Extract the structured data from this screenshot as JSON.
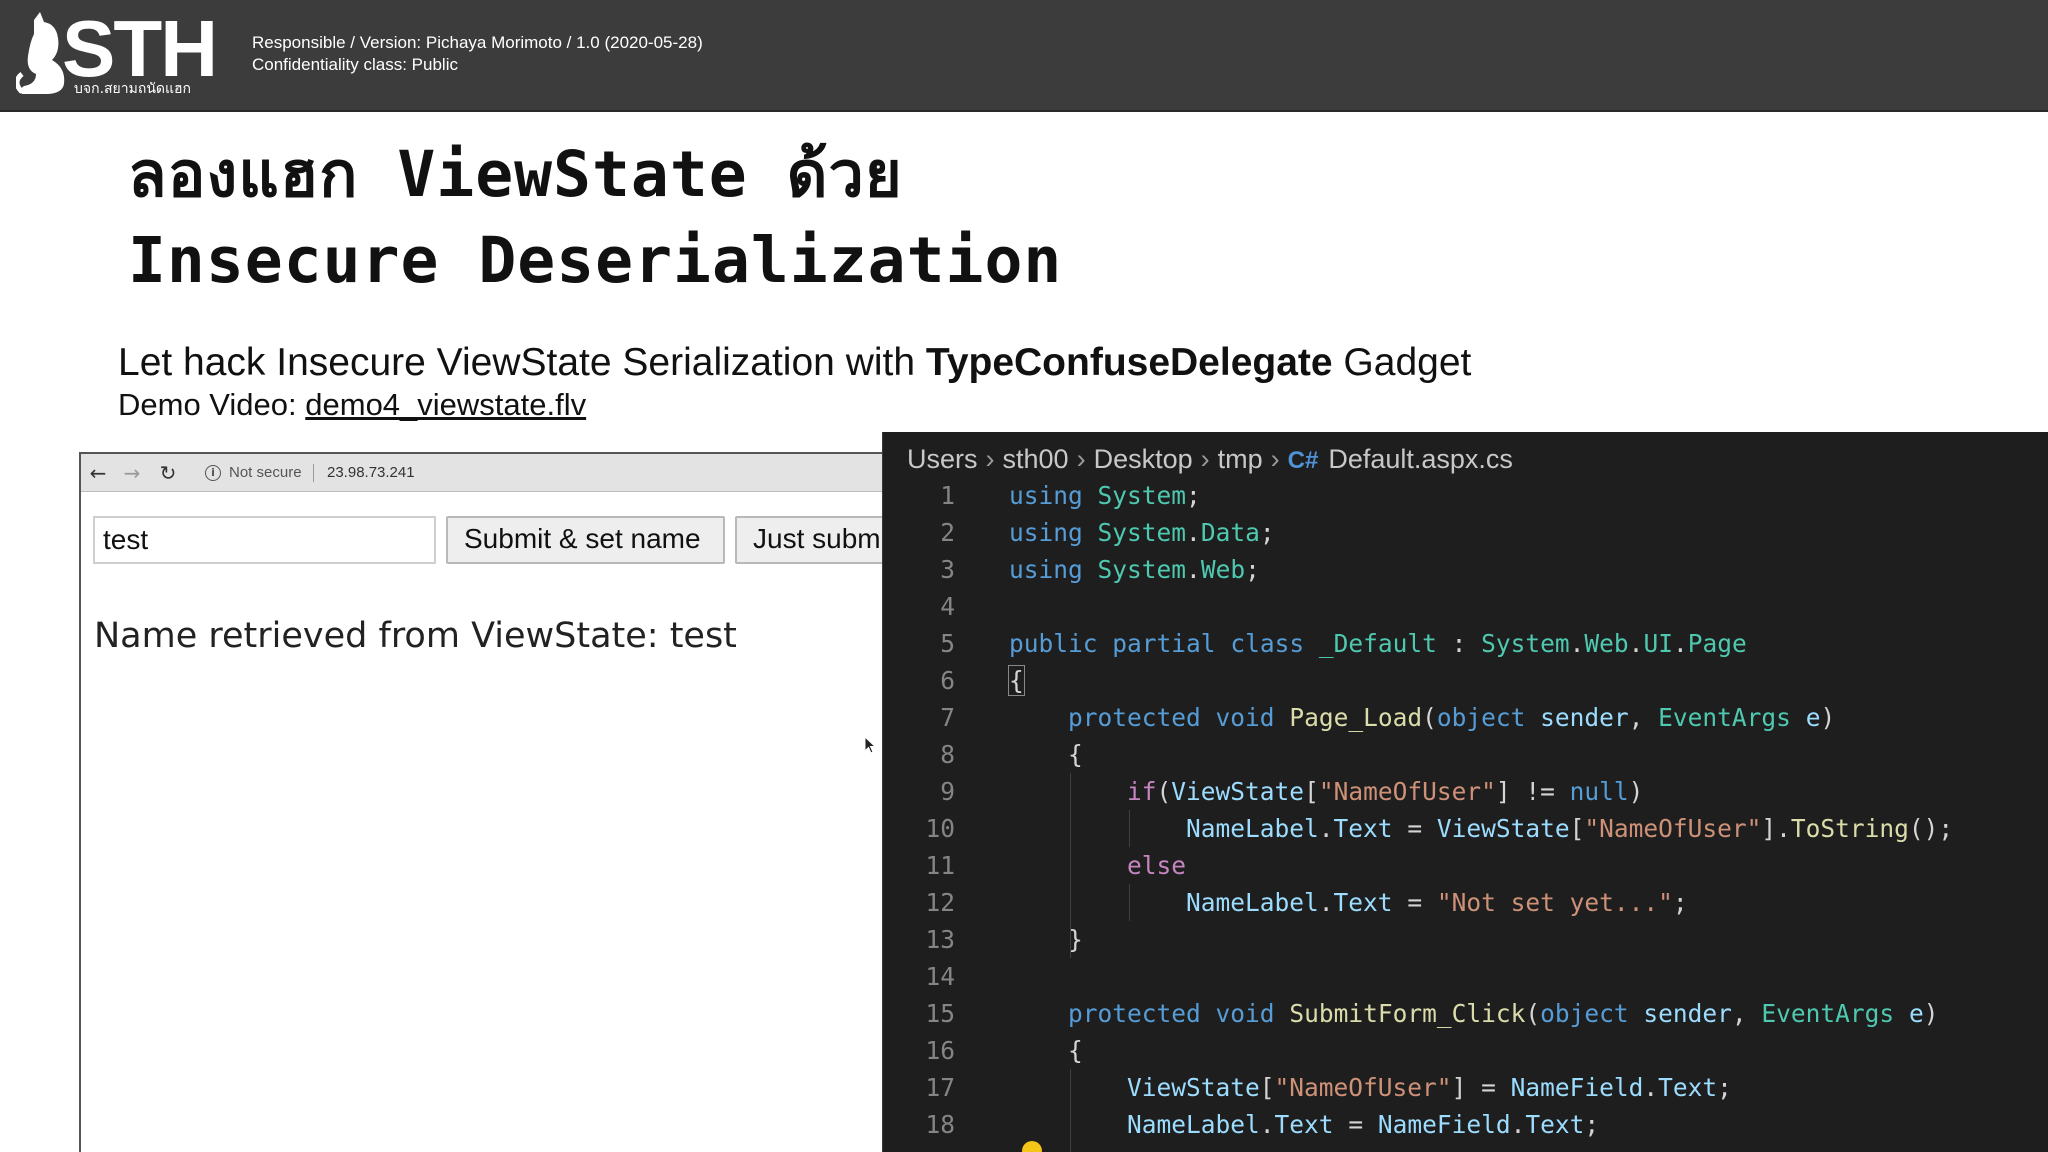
{
  "header": {
    "logo_text": "STH",
    "logo_subtext": "บจก.สยามถนัดแฮก",
    "responsible_line": "Responsible / Version: Pichaya Morimoto / 1.0 (2020-05-28)",
    "confidentiality_line": "Confidentiality class: Public"
  },
  "slide": {
    "title_line1": "ลองแฮก ViewState ด้วย",
    "title_line2": "Insecure Deserialization",
    "subtitle_prefix": "Let hack Insecure ViewState Serialization with ",
    "subtitle_bold": "TypeConfuseDelegate",
    "subtitle_suffix": " Gadget",
    "demo_label": "Demo Video: ",
    "demo_link": "demo4_viewstate.flv"
  },
  "browser": {
    "not_secure": "Not secure",
    "url": "23.98.73.241",
    "name_value": "test",
    "submit_button": "Submit & set name",
    "just_submit_button": "Just subm",
    "result_text": "Name retrieved from ViewState: test",
    "icons": [
      "back-arrow-icon",
      "forward-arrow-icon",
      "reload-icon",
      "info-icon"
    ]
  },
  "editor": {
    "breadcrumbs": [
      "Users",
      "sth00",
      "Desktop",
      "tmp",
      "Default.aspx.cs"
    ],
    "file_icon": "C#",
    "colors": {
      "background": "#1e1e1e",
      "keyword": "#569cd6",
      "control": "#c586c0",
      "type": "#4ec9b0",
      "function": "#dcdcaa",
      "variable": "#9cdcfe",
      "string": "#ce9178"
    },
    "lines": [
      {
        "n": "1",
        "tokens": [
          [
            "kw",
            "using"
          ],
          [
            "pl",
            " "
          ],
          [
            "ty",
            "System"
          ],
          [
            "pl",
            ";"
          ]
        ]
      },
      {
        "n": "2",
        "tokens": [
          [
            "kw",
            "using"
          ],
          [
            "pl",
            " "
          ],
          [
            "ty",
            "System"
          ],
          [
            "pl",
            "."
          ],
          [
            "ty",
            "Data"
          ],
          [
            "pl",
            ";"
          ]
        ]
      },
      {
        "n": "3",
        "tokens": [
          [
            "kw",
            "using"
          ],
          [
            "pl",
            " "
          ],
          [
            "ty",
            "System"
          ],
          [
            "pl",
            "."
          ],
          [
            "ty",
            "Web"
          ],
          [
            "pl",
            ";"
          ]
        ]
      },
      {
        "n": "4",
        "tokens": []
      },
      {
        "n": "5",
        "tokens": [
          [
            "kw",
            "public"
          ],
          [
            "pl",
            " "
          ],
          [
            "kw",
            "partial"
          ],
          [
            "pl",
            " "
          ],
          [
            "kw",
            "class"
          ],
          [
            "pl",
            " "
          ],
          [
            "ty",
            "_Default"
          ],
          [
            "pl",
            " : "
          ],
          [
            "ty",
            "System"
          ],
          [
            "pl",
            "."
          ],
          [
            "ty",
            "Web"
          ],
          [
            "pl",
            "."
          ],
          [
            "ty",
            "UI"
          ],
          [
            "pl",
            "."
          ],
          [
            "ty",
            "Page"
          ]
        ]
      },
      {
        "n": "6",
        "tokens": [
          [
            "pl",
            "{"
          ]
        ]
      },
      {
        "n": "7",
        "tokens": [
          [
            "pl",
            "    "
          ],
          [
            "kw",
            "protected"
          ],
          [
            "pl",
            " "
          ],
          [
            "kw",
            "void"
          ],
          [
            "pl",
            " "
          ],
          [
            "fn",
            "Page_Load"
          ],
          [
            "pl",
            "("
          ],
          [
            "kw",
            "object"
          ],
          [
            "pl",
            " "
          ],
          [
            "var",
            "sender"
          ],
          [
            "pl",
            ", "
          ],
          [
            "ty",
            "EventArgs"
          ],
          [
            "pl",
            " "
          ],
          [
            "var",
            "e"
          ],
          [
            "pl",
            ")"
          ]
        ]
      },
      {
        "n": "8",
        "tokens": [
          [
            "pl",
            "    {"
          ]
        ]
      },
      {
        "n": "9",
        "tokens": [
          [
            "pl",
            "        "
          ],
          [
            "kw2",
            "if"
          ],
          [
            "pl",
            "("
          ],
          [
            "var",
            "ViewState"
          ],
          [
            "pl",
            "["
          ],
          [
            "str",
            "\"NameOfUser\""
          ],
          [
            "pl",
            "] != "
          ],
          [
            "kw",
            "null"
          ],
          [
            "pl",
            ")"
          ]
        ]
      },
      {
        "n": "10",
        "tokens": [
          [
            "pl",
            "            "
          ],
          [
            "var",
            "NameLabel"
          ],
          [
            "pl",
            "."
          ],
          [
            "var",
            "Text"
          ],
          [
            "pl",
            " = "
          ],
          [
            "var",
            "ViewState"
          ],
          [
            "pl",
            "["
          ],
          [
            "str",
            "\"NameOfUser\""
          ],
          [
            "pl",
            "]."
          ],
          [
            "fn",
            "ToString"
          ],
          [
            "pl",
            "();"
          ]
        ]
      },
      {
        "n": "11",
        "tokens": [
          [
            "pl",
            "        "
          ],
          [
            "kw2",
            "else"
          ]
        ]
      },
      {
        "n": "12",
        "tokens": [
          [
            "pl",
            "            "
          ],
          [
            "var",
            "NameLabel"
          ],
          [
            "pl",
            "."
          ],
          [
            "var",
            "Text"
          ],
          [
            "pl",
            " = "
          ],
          [
            "str",
            "\"Not set yet...\""
          ],
          [
            "pl",
            ";"
          ]
        ]
      },
      {
        "n": "13",
        "tokens": [
          [
            "pl",
            "    }"
          ]
        ]
      },
      {
        "n": "14",
        "tokens": []
      },
      {
        "n": "15",
        "tokens": [
          [
            "pl",
            "    "
          ],
          [
            "kw",
            "protected"
          ],
          [
            "pl",
            " "
          ],
          [
            "kw",
            "void"
          ],
          [
            "pl",
            " "
          ],
          [
            "fn",
            "SubmitForm_Click"
          ],
          [
            "pl",
            "("
          ],
          [
            "kw",
            "object"
          ],
          [
            "pl",
            " "
          ],
          [
            "var",
            "sender"
          ],
          [
            "pl",
            ", "
          ],
          [
            "ty",
            "EventArgs"
          ],
          [
            "pl",
            " "
          ],
          [
            "var",
            "e"
          ],
          [
            "pl",
            ")"
          ]
        ]
      },
      {
        "n": "16",
        "tokens": [
          [
            "pl",
            "    {"
          ]
        ]
      },
      {
        "n": "17",
        "tokens": [
          [
            "pl",
            "        "
          ],
          [
            "var",
            "ViewState"
          ],
          [
            "pl",
            "["
          ],
          [
            "str",
            "\"NameOfUser\""
          ],
          [
            "pl",
            "] = "
          ],
          [
            "var",
            "NameField"
          ],
          [
            "pl",
            "."
          ],
          [
            "var",
            "Text"
          ],
          [
            "pl",
            ";"
          ]
        ]
      },
      {
        "n": "18",
        "tokens": [
          [
            "pl",
            "        "
          ],
          [
            "var",
            "NameLabel"
          ],
          [
            "pl",
            "."
          ],
          [
            "var",
            "Text"
          ],
          [
            "pl",
            " = "
          ],
          [
            "var",
            "NameField"
          ],
          [
            "pl",
            "."
          ],
          [
            "var",
            "Text"
          ],
          [
            "pl",
            ";"
          ]
        ]
      }
    ]
  }
}
